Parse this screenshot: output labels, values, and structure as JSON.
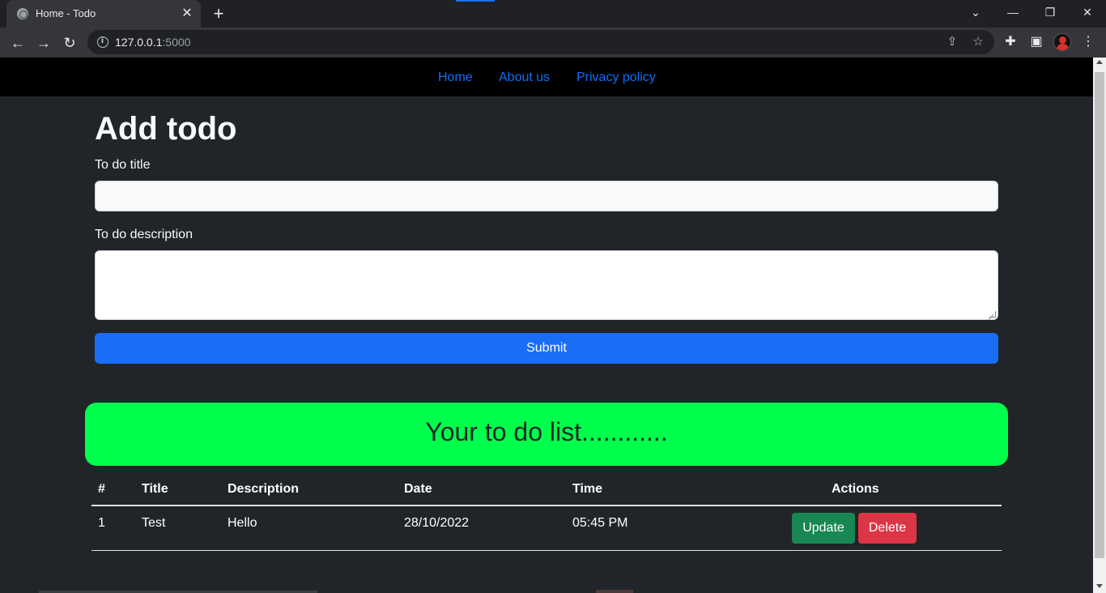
{
  "browser": {
    "tab_title": "Home - Todo",
    "url_host": "127.0.0.1",
    "url_port": ":5000"
  },
  "navbar": {
    "links": [
      "Home",
      "About us",
      "Privacy policy"
    ],
    "link_color": "#0d6efd"
  },
  "form": {
    "heading": "Add todo",
    "title_label": "To do title",
    "title_value": "",
    "description_label": "To do description",
    "description_value": "",
    "submit_label": "Submit"
  },
  "list": {
    "banner_text": "Your to do list............",
    "banner_color": "#00ff4c",
    "columns": [
      "#",
      "Title",
      "Description",
      "Date",
      "Time",
      "Actions"
    ],
    "rows": [
      {
        "num": "1",
        "title": "Test",
        "description": "Hello",
        "date": "28/10/2022",
        "time": "05:45 PM"
      }
    ],
    "update_label": "Update",
    "delete_label": "Delete"
  },
  "colors": {
    "page_bg": "#212529",
    "primary": "#1a6ef5",
    "success": "#198754",
    "danger": "#dc3545"
  },
  "icons": {
    "back": "arrow-left-icon",
    "forward": "arrow-right-icon",
    "reload": "reload-icon",
    "info": "info-icon",
    "share": "share-icon",
    "bookmark": "star-icon",
    "extensions": "puzzle-icon",
    "sidepanel": "side-panel-icon",
    "menu": "kebab-menu-icon"
  }
}
